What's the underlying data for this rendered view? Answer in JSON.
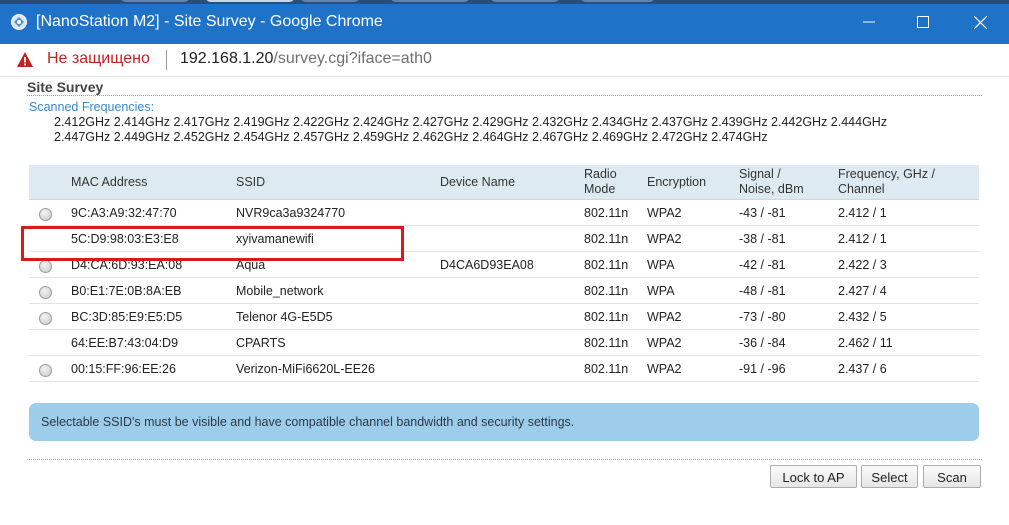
{
  "window": {
    "title": "[NanoStation M2] - Site Survey - Google Chrome",
    "minimize_label": "—",
    "maximize_label": "☐",
    "close_label": "✕"
  },
  "address_bar": {
    "security_text": "Не защищено",
    "url_host": "192.168.1.20",
    "url_path": "/survey.cgi?iface=ath0"
  },
  "page": {
    "title": "Site Survey",
    "scanned_label": "Scanned Frequencies:",
    "frequencies_line1": "2.412GHz 2.414GHz 2.417GHz 2.419GHz 2.422GHz 2.424GHz 2.427GHz 2.429GHz 2.432GHz 2.434GHz 2.437GHz 2.439GHz 2.442GHz 2.444GHz",
    "frequencies_line2": "2.447GHz 2.449GHz 2.452GHz 2.454GHz 2.457GHz 2.459GHz 2.462GHz 2.464GHz 2.467GHz 2.469GHz 2.472GHz 2.474GHz"
  },
  "table": {
    "headers": {
      "mac": "MAC Address",
      "ssid": "SSID",
      "device": "Device Name",
      "radio_1": "Radio",
      "radio_2": "Mode",
      "encryption": "Encryption",
      "signal_1": "Signal /",
      "signal_2": "Noise, dBm",
      "freq_1": "Frequency, GHz /",
      "freq_2": "Channel"
    },
    "rows": [
      {
        "selectable": true,
        "mac": "9C:A3:A9:32:47:70",
        "ssid": "NVR9ca3a9324770",
        "device": "",
        "mode": "802.11n",
        "encryption": "WPA2",
        "signal": "-43 / -81",
        "freq": "2.412 / 1"
      },
      {
        "selectable": false,
        "mac": "5C:D9:98:03:E3:E8",
        "ssid": "xyivamanewifi",
        "device": "",
        "mode": "802.11n",
        "encryption": "WPA2",
        "signal": "-38 / -81",
        "freq": "2.412 / 1"
      },
      {
        "selectable": true,
        "mac": "D4:CA:6D:93:EA:08",
        "ssid": "Aqua",
        "device": "D4CA6D93EA08",
        "mode": "802.11n",
        "encryption": "WPA",
        "signal": "-42 / -81",
        "freq": "2.422 / 3"
      },
      {
        "selectable": true,
        "mac": "B0:E1:7E:0B:8A:EB",
        "ssid": "Mobile_network",
        "device": "",
        "mode": "802.11n",
        "encryption": "WPA",
        "signal": "-48 / -81",
        "freq": "2.427 / 4"
      },
      {
        "selectable": true,
        "mac": "BC:3D:85:E9:E5:D5",
        "ssid": "Telenor 4G-E5D5",
        "device": "",
        "mode": "802.11n",
        "encryption": "WPA2",
        "signal": "-73 / -80",
        "freq": "2.432 / 5"
      },
      {
        "selectable": false,
        "mac": "64:EE:B7:43:04:D9",
        "ssid": "CPARTS",
        "device": "",
        "mode": "802.11n",
        "encryption": "WPA2",
        "signal": "-36 / -84",
        "freq": "2.462 / 11"
      },
      {
        "selectable": true,
        "mac": "00:15:FF:96:EE:26",
        "ssid": "Verizon-MiFi6620L-EE26",
        "device": "",
        "mode": "802.11n",
        "encryption": "WPA2",
        "signal": "-91 / -96",
        "freq": "2.437 / 6"
      }
    ]
  },
  "notice": "Selectable SSID's must be visible and have compatible channel bandwidth and security settings.",
  "buttons": {
    "lock": "Lock to AP",
    "select": "Select",
    "scan": "Scan"
  },
  "colors": {
    "titlebar": "#1e72c8",
    "insecure_text": "#c5221f",
    "highlight_box": "#d71a1a",
    "notice_bg": "#9dcdeb",
    "header_bg": "#ddeaf1"
  },
  "icons": {
    "app": "nanostation-app-icon",
    "security": "warning-triangle-icon"
  }
}
